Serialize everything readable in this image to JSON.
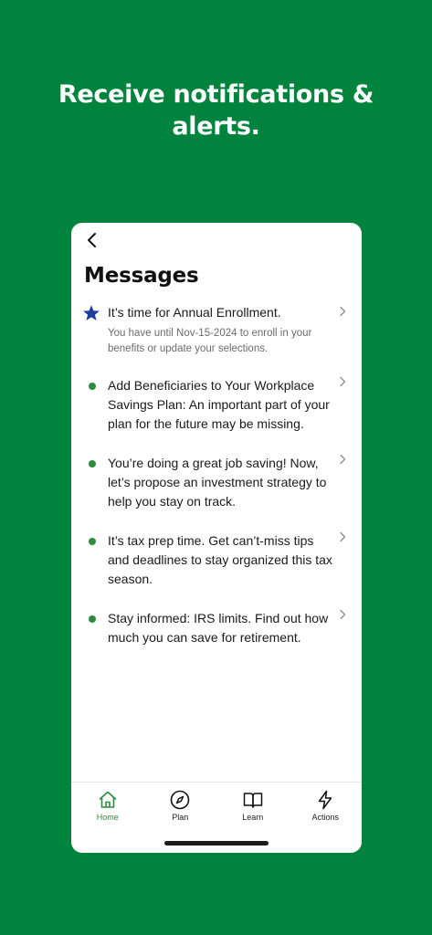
{
  "promo": {
    "headline_line1": "Receive notifications &",
    "headline_line2": "alerts."
  },
  "screen": {
    "title": "Messages",
    "back_icon": "chevron-left-icon"
  },
  "messages": [
    {
      "marker": "star-icon",
      "text": "It’s time for Annual Enrollment.",
      "subtext": "You have until Nov-15-2024 to enroll in your benefits or update your selections."
    },
    {
      "marker": "dot-icon",
      "text": "Add Beneficiaries to Your Workplace Savings Plan: An important part of your plan for the future may be missing."
    },
    {
      "marker": "dot-icon",
      "text": "You’re doing a great job saving! Now, let’s propose an investment strategy to help you stay on track."
    },
    {
      "marker": "dot-icon",
      "text": "It’s tax prep time. Get can’t-miss tips and deadlines to stay organized this tax season."
    },
    {
      "marker": "dot-icon",
      "text": "Stay informed: IRS limits. Find out how much you can save for retirement."
    }
  ],
  "tabbar": {
    "items": [
      {
        "label": "Home",
        "icon": "home-icon",
        "active": true
      },
      {
        "label": "Plan",
        "icon": "compass-icon",
        "active": false
      },
      {
        "label": "Learn",
        "icon": "book-icon",
        "active": false
      },
      {
        "label": "Actions",
        "icon": "lightning-icon",
        "active": false
      }
    ]
  },
  "colors": {
    "background": "#00843d",
    "accent": "#2e8b3e",
    "star": "#1b3f9e"
  }
}
